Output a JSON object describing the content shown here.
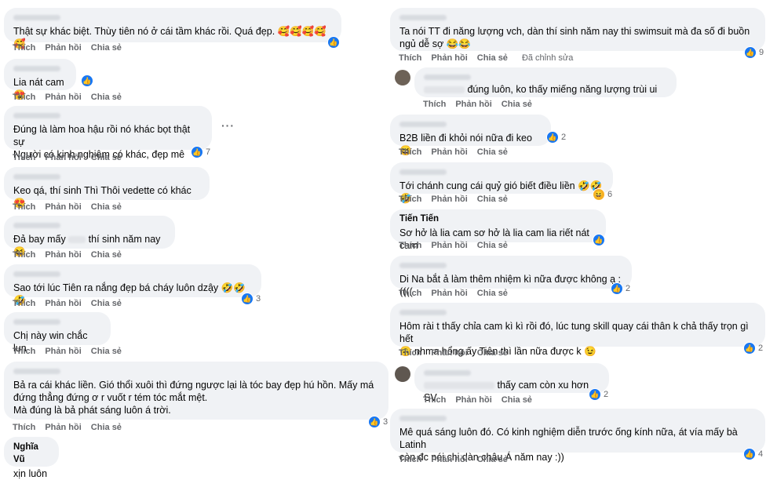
{
  "actions": {
    "like": "Thích",
    "reply": "Phản hồi",
    "share": "Chia sẻ",
    "edited": "Đã chỉnh sửa"
  },
  "left": [
    {
      "text": "Thật sự khác biệt. Thùy tiên nó ở cái tầm khác rồi. Quá đẹp. 🥰🥰🥰🥰🥰",
      "count": ""
    },
    {
      "text": "Lia nát cam 😍",
      "count": ""
    },
    {
      "text": "Đúng là làm hoa hậu rồi nó khác bọt thật sự\nNgười có kinh nghiệm có khác, đẹp mê",
      "count": "7"
    },
    {
      "text": "Keo qá, thí sinh Thì Thôi vedette có khác 😍",
      "count": ""
    },
    {
      "text": "Đả bay mấy",
      "text2": "thí sinh năm nay 😆",
      "count": ""
    },
    {
      "text": "Sao tới lúc Tiên ra nắng đẹp bá cháy luôn dzậy 🤣🤣🤣",
      "count": "3"
    },
    {
      "text": "Chị này win chắc lun",
      "count": ""
    },
    {
      "text": "Bả ra cái khác liền. Gió thổi xuôi thì đứng ngược lại là tóc bay đẹp hú hồn. Mấy má\nđứng thẳng đứng ơ r vuốt r tém tóc mắt mệt.\nMà đúng là bả phát sáng luôn á trời.",
      "count": "3"
    },
    {
      "author": "Nghĩa Vũ",
      "text": "xịn luôn",
      "count": ""
    }
  ],
  "right": [
    {
      "text": "Ta nói TT đi năng lượng vch, dàn thí sinh năm nay thi swimsuit mà đa số đi buồn\nngủ dễ sợ 😂😂",
      "count": "9"
    },
    {
      "text": "đúng luôn, ko thấy miếng năng lượng trùi ui",
      "count": ""
    },
    {
      "text": "B2B liền đi khỏi nói nữa đi keo 😆",
      "count": "2"
    },
    {
      "text": "Tới chánh cung cái quỷ gió biết điều liền 🤣🤣🤣",
      "count": "6"
    },
    {
      "author": "Tiến Tiến",
      "text": "Sơ hở là lia cam sơ hở là lia cam lia riết nát cam",
      "count": ""
    },
    {
      "text": "Di Na bắt ả làm thêm nhiệm kì nữa được không ạ :((((",
      "count": "2"
    },
    {
      "text": "Hôm rài t thấy chỉa cam kì kì rồi đó, lúc tung skill quay cái thân k chả thấy trọn gì hết\n🙃 nhma hổng ấy Tiên thì lần nữa được k 😉",
      "count": "2"
    },
    {
      "text": "thấy cam còn xu hơn SV",
      "count": "2"
    },
    {
      "text": "Mê quá sáng luôn đó. Có kinh nghiệm diễn trước ống kính nữa, át vía mấy bà Latinh\ncòn đc nói chi dàn châu Á năm nay :))",
      "count": "4"
    }
  ]
}
